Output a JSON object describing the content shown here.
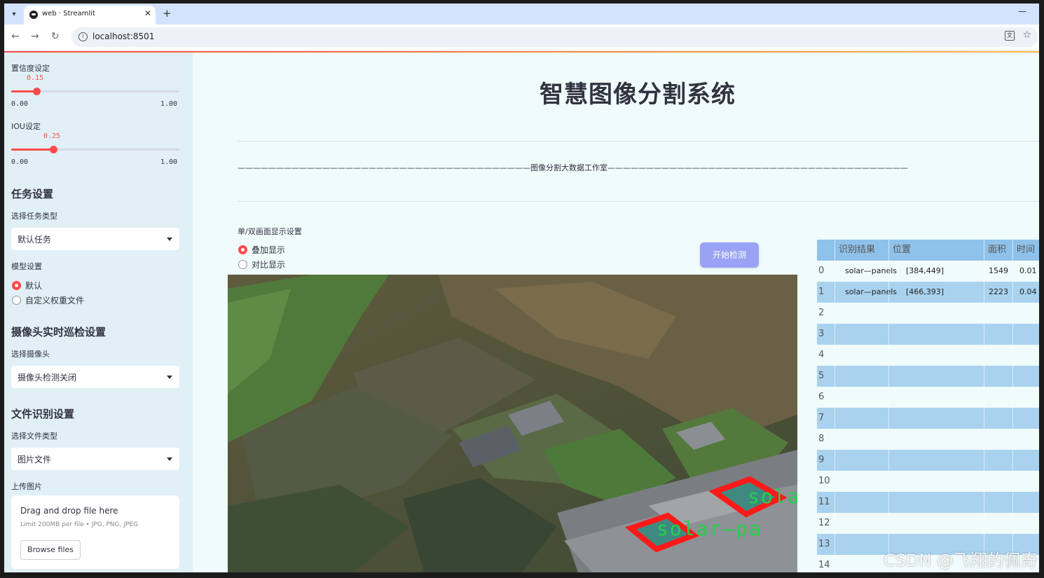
{
  "browser": {
    "tab_title": "web · Streamlit",
    "url": "localhost:8501",
    "new_tab": "+",
    "close": "✕",
    "minimize": "—"
  },
  "sidebar": {
    "confidence": {
      "label": "置信度设定",
      "value": "0.15",
      "min": "0.00",
      "max": "1.00",
      "fraction": 0.15
    },
    "iou": {
      "label": "IOU设定",
      "value": "0.25",
      "min": "0.00",
      "max": "1.00",
      "fraction": 0.25
    },
    "task": {
      "heading": "任务设置",
      "label": "选择任务类型",
      "selected": "默认任务"
    },
    "model": {
      "label": "模型设置",
      "options": [
        "默认",
        "自定义权重文件"
      ],
      "selected_index": 0
    },
    "camera": {
      "heading": "摄像头实时巡检设置",
      "label": "选择摄像头",
      "selected": "摄像头检测关闭"
    },
    "file": {
      "heading": "文件识别设置",
      "label": "选择文件类型",
      "selected": "图片文件"
    },
    "upload": {
      "label": "上传图片",
      "drop_text": "Drag and drop file here",
      "limit_text": "Limit 200MB per file • JPG, PNG, JPEG",
      "browse_label": "Browse files"
    }
  },
  "main": {
    "title": "智慧图像分割系统",
    "subtitle": "——————————————————————————————————————图像分割大数据工作室———————————————————————————————————————",
    "display": {
      "label": "单/双画面显示设置",
      "options": [
        "叠加显示",
        "对比显示"
      ],
      "selected_index": 0
    },
    "start_button": "开始检测",
    "overlay_labels": [
      "solar—pa",
      "sola"
    ]
  },
  "results_table": {
    "headers": [
      "识别结果",
      "位置",
      "面积",
      "时间"
    ],
    "rows": [
      {
        "index": "0",
        "result": "solar—panels",
        "position": "[384,449]",
        "area": "1549",
        "time": "0.01"
      },
      {
        "index": "1",
        "result": "solar—panels",
        "position": "[466,393]",
        "area": "2223",
        "time": "0.04"
      },
      {
        "index": "2"
      },
      {
        "index": "3"
      },
      {
        "index": "4"
      },
      {
        "index": "5"
      },
      {
        "index": "6"
      },
      {
        "index": "7"
      },
      {
        "index": "8"
      },
      {
        "index": "9"
      },
      {
        "index": "10"
      },
      {
        "index": "11"
      },
      {
        "index": "12"
      },
      {
        "index": "13"
      },
      {
        "index": "14"
      }
    ]
  },
  "watermark": "CSDN @飞翔的佩奇",
  "colors": {
    "accent": "#ff4b4b",
    "button": "#9aa2f5",
    "table_header": "#8fc2ea",
    "table_stripe": "#a9d2ef",
    "sidebar_bg": "#e1f0f7"
  }
}
